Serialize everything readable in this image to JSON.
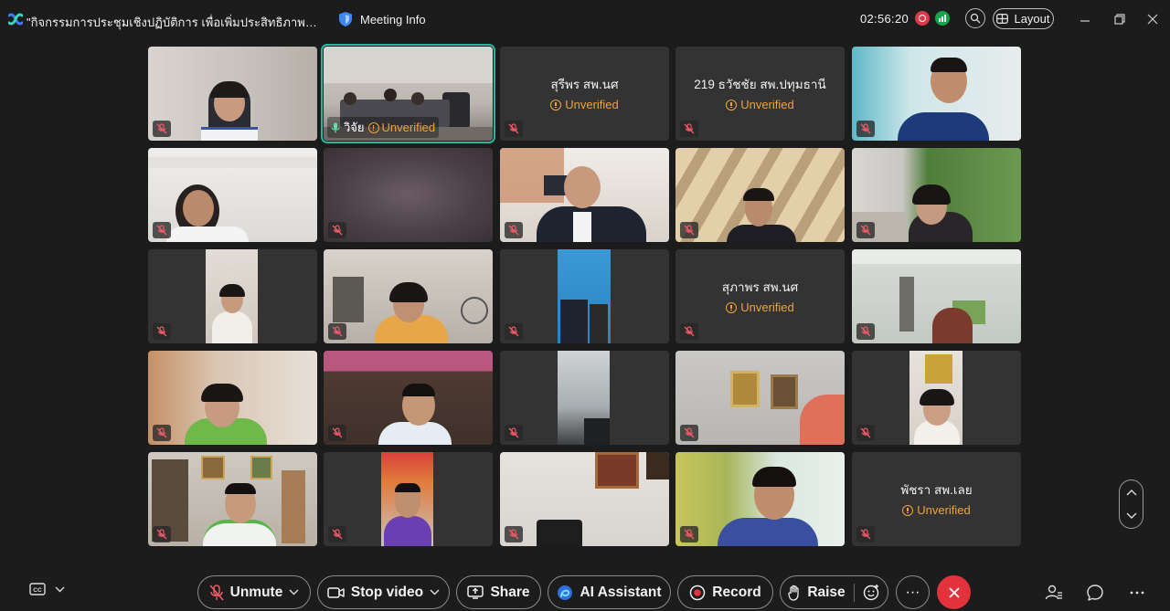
{
  "window": {
    "title": "\"กิจกรรมการประชุมเชิงปฏิบัติการ เพื่อเพิ่มประสิทธิภาพการพัฒนาระบ...",
    "meeting_info_label": "Meeting Info",
    "clock": "02:56:20",
    "layout_label": "Layout"
  },
  "colors": {
    "background": "#1c1c1c",
    "tile_placeholder": "#333333",
    "active_speaker_border": "#2ab5a0",
    "unverified": "#f0a33c",
    "leave": "#e3323c",
    "recording": "#e0384a",
    "stats": "#17a34a"
  },
  "participants": [
    {
      "id": "p1",
      "name": "",
      "unverified": false,
      "video": true,
      "muted": true
    },
    {
      "id": "p2",
      "name": "วิจัย",
      "unverified_label": "Unverified",
      "video": true,
      "muted": false,
      "active_speaker": true
    },
    {
      "id": "p3",
      "name": "สุรีพร สพ.นศ",
      "unverified_label": "Unverified",
      "video": false,
      "muted": true
    },
    {
      "id": "p4",
      "name": "219 ธวัชชัย สพ.ปทุมธานี",
      "unverified_label": "Unverified",
      "video": false,
      "muted": true
    },
    {
      "id": "p5",
      "name": "",
      "video": true,
      "muted": true
    },
    {
      "id": "p6",
      "name": "",
      "video": true,
      "muted": true
    },
    {
      "id": "p7",
      "name": "",
      "video": true,
      "muted": true
    },
    {
      "id": "p8",
      "name": "",
      "video": true,
      "muted": true
    },
    {
      "id": "p9",
      "name": "",
      "video": true,
      "muted": true
    },
    {
      "id": "p10",
      "name": "",
      "video": true,
      "muted": true
    },
    {
      "id": "p11",
      "name": "",
      "video": true,
      "muted": true
    },
    {
      "id": "p12",
      "name": "",
      "video": true,
      "muted": true
    },
    {
      "id": "p13",
      "name": "",
      "video": true,
      "muted": true
    },
    {
      "id": "p14",
      "name": "สุภาพร สพ.นศ",
      "unverified_label": "Unverified",
      "video": false,
      "muted": true
    },
    {
      "id": "p15",
      "name": "",
      "video": true,
      "muted": true
    },
    {
      "id": "p16",
      "name": "",
      "video": true,
      "muted": true
    },
    {
      "id": "p17",
      "name": "",
      "video": true,
      "muted": true
    },
    {
      "id": "p18",
      "name": "",
      "video": true,
      "muted": true
    },
    {
      "id": "p19",
      "name": "",
      "video": true,
      "muted": true
    },
    {
      "id": "p20",
      "name": "",
      "video": true,
      "muted": true
    },
    {
      "id": "p21",
      "name": "",
      "video": true,
      "muted": true
    },
    {
      "id": "p22",
      "name": "",
      "video": true,
      "muted": true
    },
    {
      "id": "p23",
      "name": "",
      "video": true,
      "muted": true
    },
    {
      "id": "p24",
      "name": "",
      "video": true,
      "muted": true
    },
    {
      "id": "p25",
      "name": "พัชรา สพ.เลย",
      "unverified_label": "Unverified",
      "video": false,
      "muted": true
    }
  ],
  "toolbar": {
    "unmute": "Unmute",
    "stop_video": "Stop video",
    "share": "Share",
    "ai_assistant": "AI Assistant",
    "record": "Record",
    "raise": "Raise",
    "more": "···"
  }
}
